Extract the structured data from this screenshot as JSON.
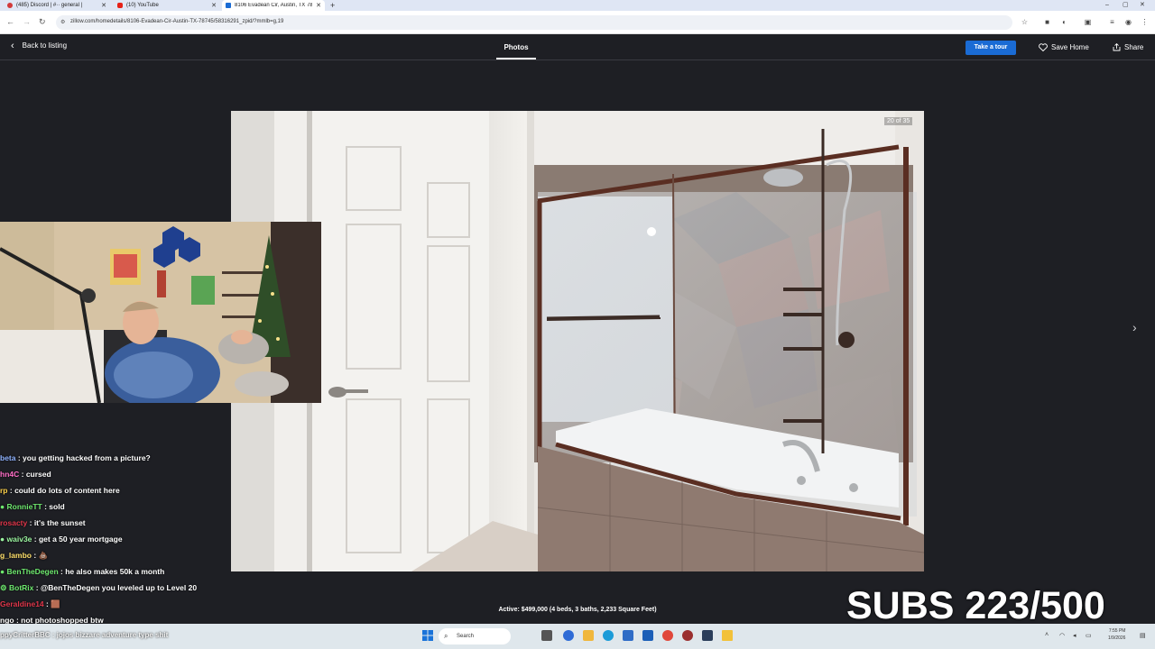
{
  "browser": {
    "tabs": [
      {
        "label": "(485) Discord | #·· general |",
        "active": false,
        "favicon_color": "#d23a3a"
      },
      {
        "label": "(10) YouTube",
        "active": false,
        "favicon_color": "#e62117"
      },
      {
        "label": "8106 Evadean Cir, Austin, TX 78...",
        "active": true,
        "favicon_color": "#1a6bd4"
      }
    ],
    "url": "zillow.com/homedetails/8106-Evadean-Cir-Austin-TX-78745/58316291_zpid/?mmlb=g,19"
  },
  "header": {
    "back_label": "Back to listing",
    "active_tab": "Photos",
    "tour_button": "Take a tour",
    "save_label": "Save Home",
    "share_label": "Share"
  },
  "photo": {
    "counter": "20 of 35",
    "caption": "Active: $499,000 (4 beds, 3 baths, 2,233 Square Feet)"
  },
  "chat": [
    {
      "user": "beta",
      "msg": "you getting hacked from a picture?",
      "color": "#8fb3ff"
    },
    {
      "user": "hn4C",
      "msg": "cursed",
      "color": "#ff6ec7"
    },
    {
      "user": "rp",
      "msg": "could do lots of content here",
      "color": "#ffd24a"
    },
    {
      "user": "RonnieTT",
      "msg": "sold",
      "color": "#6ee86e"
    },
    {
      "user": "rosacty",
      "msg": "it's the sunset",
      "color": "#e0364a"
    },
    {
      "user": "waiv3e",
      "msg": "get a 50 year mortgage",
      "color": "#9bf5a0"
    },
    {
      "user": "g_lambo",
      "msg": "💩",
      "color": "#ffe06b"
    },
    {
      "user": "BenTheDegen",
      "msg": "he also makes 50k a month",
      "color": "#6ee86e"
    },
    {
      "user": "BotRix",
      "msg": "@BenTheDegen you leveled up to Level 20",
      "color": "#6ee86e"
    },
    {
      "user": "Geraldine14",
      "msg": "🟫",
      "color": "#e0364a"
    },
    {
      "user": "ngo",
      "msg": "not photoshopped btw",
      "color": "#ffffff"
    }
  ],
  "overlay_bottom": "ppyCritterBBC : jojos bizzare adventure type shit",
  "subs": "SUBS 223/500",
  "taskbar": {
    "search_label": "Search",
    "time": "7:55 PM",
    "date": "1/9/2026"
  },
  "colors": {
    "background": "#1e1f24",
    "brand_blue": "#1a6bd4"
  }
}
